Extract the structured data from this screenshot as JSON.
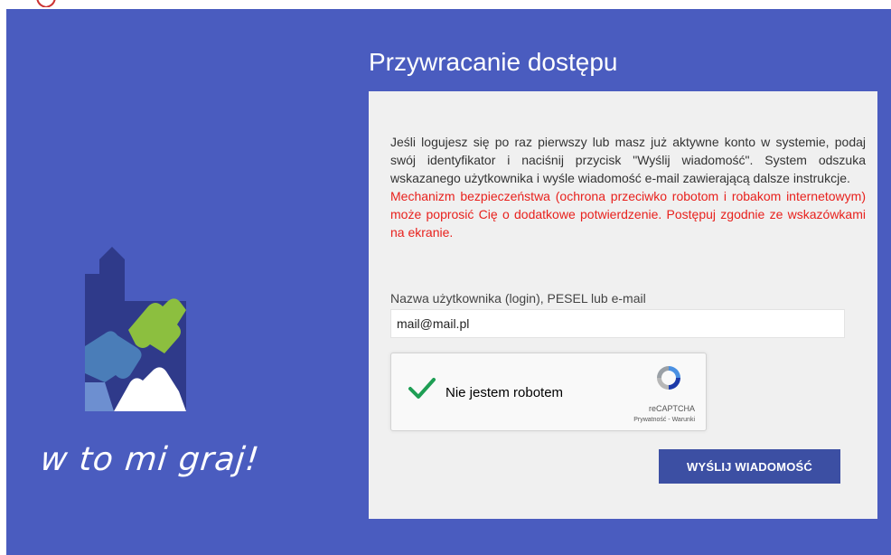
{
  "colors": {
    "background": "#4a5cbf",
    "panel": "#f0f0f0",
    "warning": "#e8211d",
    "button": "#3c4fa3"
  },
  "branding": {
    "logo_icon": "puzzle-tower-icon",
    "slogan": "w to mi graj!"
  },
  "page": {
    "title": "Przywracanie dostępu"
  },
  "form": {
    "intro_text": "Jeśli logujesz się po raz pierwszy lub masz już aktywne konto w systemie, podaj swój identyfikator i naciśnij przycisk \"Wyślij wiadomość\". System odszuka wskazanego użytkownika i wyśle wiadomość e-mail zawierającą dalsze instrukcje.",
    "warning_text": "Mechanizm bezpieczeństwa (ochrona przeciwko robotom i robakom internetowym) może poprosić Cię o dodatkowe potwierdzenie. Postępuj zgodnie ze wskazówkami na ekranie.",
    "login_label": "Nazwa użytkownika (login), PESEL lub e-mail",
    "login_value": "mail@mail.pl",
    "submit_label": "WYŚLIJ WIADOMOŚĆ"
  },
  "captcha": {
    "label": "Nie jestem robotem",
    "brand": "reCAPTCHA",
    "links": "Prywatność - Warunki",
    "checked": true
  }
}
